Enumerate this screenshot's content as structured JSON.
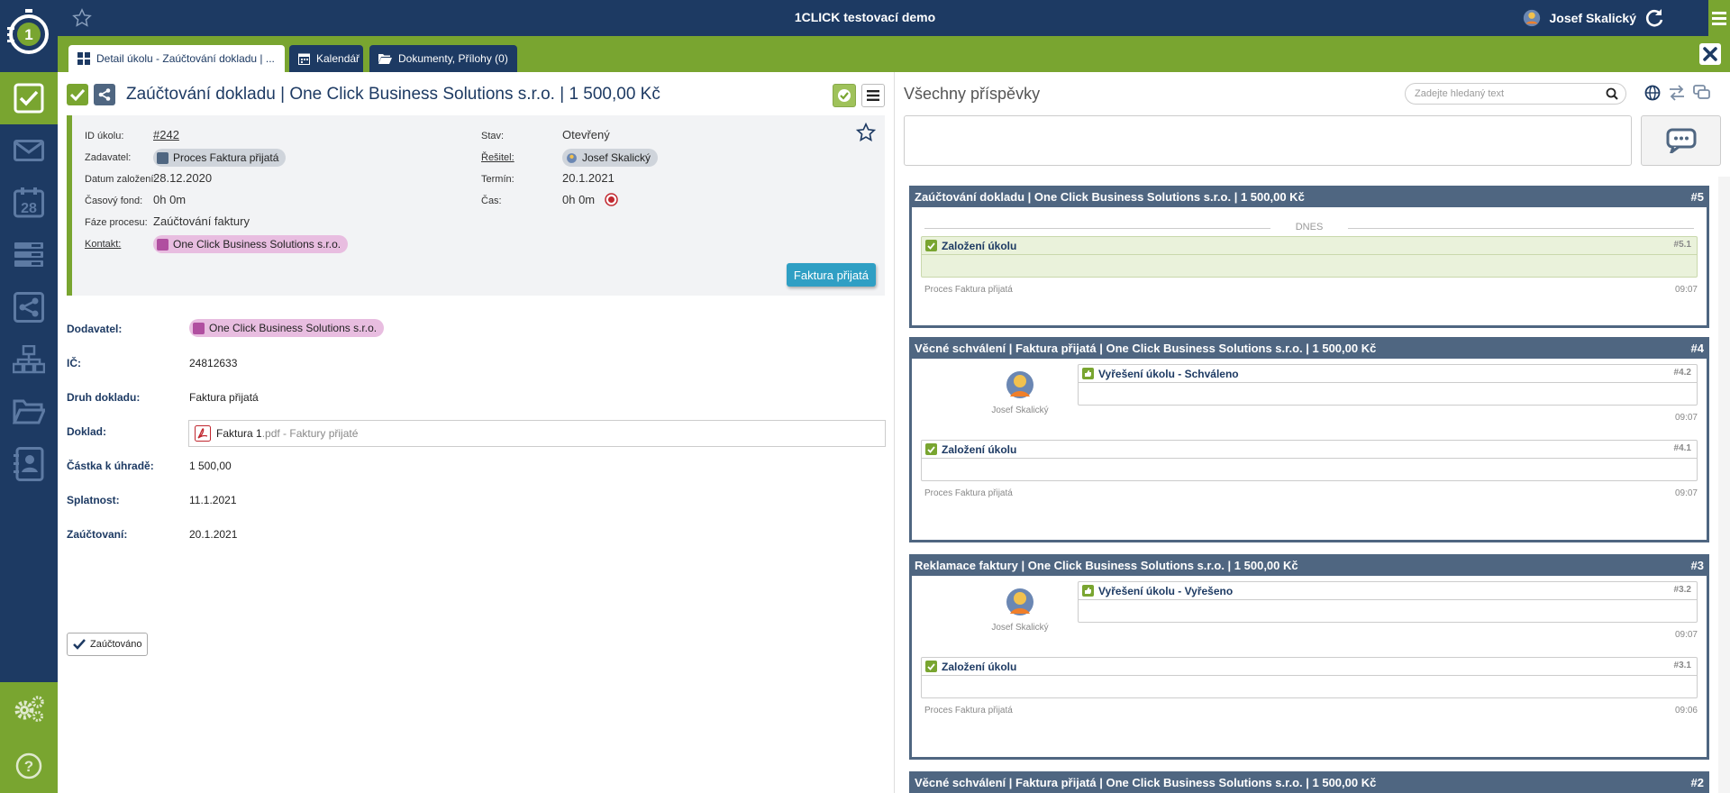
{
  "app": {
    "title": "1CLICK testovací demo",
    "user_name": "Josef Skalický"
  },
  "tabs": [
    {
      "label": "Detail úkolu - Zaúčtování dokladu | ..."
    },
    {
      "label": "Kalendář"
    },
    {
      "label": "Dokumenty, Přílohy (0)"
    }
  ],
  "sidebar": {
    "items": [
      "checklist-icon",
      "mail-icon",
      "calendar-icon",
      "list-icon",
      "process-icon",
      "org-chart-icon",
      "folder-icon",
      "contacts-icon"
    ],
    "bottom": [
      "settings-icon",
      "help-icon"
    ],
    "calendar_day": "28"
  },
  "task": {
    "title": "Zaúčtování dokladu | One Click Business Solutions s.r.o. | 1 500,00 Kč",
    "info": {
      "id_label": "ID úkolu:",
      "id_value": "#242",
      "zadavatel_label": "Zadavatel:",
      "zadavatel_value": "Proces Faktura přijatá",
      "datum_label": "Datum založení:",
      "datum_value": "28.12.2020",
      "fond_label": "Časový fond:",
      "fond_value": "0h 0m",
      "faze_label": "Fáze procesu:",
      "faze_value": "Zaúčtování faktury",
      "kontakt_label": "Kontakt:",
      "kontakt_value": "One Click Business Solutions s.r.o.",
      "stav_label": "Stav:",
      "stav_value": "Otevřený",
      "resitel_label": "Řešitel:",
      "resitel_value": "Josef Skalický",
      "termin_label": "Termín:",
      "termin_value": "20.1.2021",
      "cas_label": "Čas:",
      "cas_value": "0h 0m"
    },
    "faktura_button": "Faktura přijatá",
    "form": {
      "dodavatel_label": "Dodavatel:",
      "dodavatel_value": "One Click Business Solutions s.r.o.",
      "ic_label": "IČ:",
      "ic_value": "24812633",
      "druh_label": "Druh dokladu:",
      "druh_value": "Faktura přijatá",
      "doklad_label": "Doklad:",
      "doklad_name": "Faktura 1",
      "doklad_ext": ".pdf - Faktury přijaté",
      "castka_label": "Částka k úhradě:",
      "castka_value": "1 500,00",
      "splatnost_label": "Splatnost:",
      "splatnost_value": "11.1.2021",
      "zauctovani_label": "Zaúčtovaní:",
      "zauctovani_value": "20.1.2021"
    },
    "zauctovano_button": "Zaúčtováno"
  },
  "feed": {
    "title": "Všechny příspěvky",
    "search_placeholder": "Zadejte hledaný text",
    "today_label": "DNES",
    "threads": [
      {
        "title": "Zaúčtování dokladu | One Click Business Solutions s.r.o. | 1 500,00 Kč",
        "num": "#5",
        "posts": [
          {
            "title": "Založení úkolu",
            "num": "#5.1",
            "source": "Proces Faktura přijatá",
            "time": "09:07"
          }
        ]
      },
      {
        "title": "Věcné schválení | Faktura přijatá | One Click Business Solutions s.r.o. | 1 500,00 Kč",
        "num": "#4",
        "posts": [
          {
            "title": "Vyřešení úkolu - Schváleno",
            "num": "#4.2",
            "author": "Josef Skalický",
            "time": "09:07"
          },
          {
            "title": "Založení úkolu",
            "num": "#4.1",
            "source": "Proces Faktura přijatá",
            "time": "09:07"
          }
        ]
      },
      {
        "title": "Reklamace faktury | One Click Business Solutions s.r.o. | 1 500,00 Kč",
        "num": "#3",
        "posts": [
          {
            "title": "Vyřešení úkolu - Vyřešeno",
            "num": "#3.2",
            "author": "Josef Skalický",
            "time": "09:07"
          },
          {
            "title": "Založení úkolu",
            "num": "#3.1",
            "source": "Proces Faktura přijatá",
            "time": "09:06"
          }
        ]
      },
      {
        "title": "Věcné schválení | Faktura přijatá | One Click Business Solutions s.r.o. | 1 500,00 Kč",
        "num": "#2",
        "posts": []
      }
    ]
  },
  "colors": {
    "navy": "#1d3a63",
    "green": "#79a530",
    "thread_header": "#4f6681",
    "accent_button": "#2f9fc4",
    "contact_pill": "#e8bde0"
  }
}
